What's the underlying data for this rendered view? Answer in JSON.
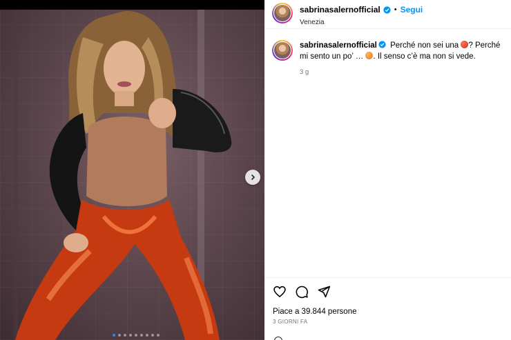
{
  "post": {
    "username": "sabrinasalernofficial",
    "separator": "•",
    "follow_label": "Segui",
    "location": "Venezia",
    "caption": {
      "username": "sabrinasalernofficial",
      "text_part1": "Perché non sei una",
      "text_part2": "? Perché mi sento un po’ …",
      "text_part3": ". Il senso c’è ma non si vede.",
      "time": "3 g"
    },
    "likes_text": "Piace a 39.844 persone",
    "date_text": "3 GIORNI FA"
  },
  "carousel": {
    "slide_count": 9,
    "active_index": 0
  },
  "colors": {
    "accent": "#0095f6",
    "verified": "#0095f6",
    "active_dot": "#2a88f2"
  },
  "icons": {
    "verified": "verified-badge-icon",
    "like": "heart-icon",
    "comment": "comment-icon",
    "share": "send-icon",
    "next": "chevron-right-icon"
  }
}
